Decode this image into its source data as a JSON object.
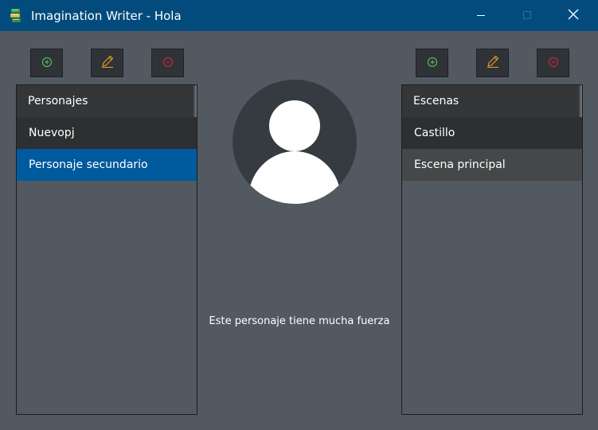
{
  "window": {
    "title": "Imagination Writer - Hola",
    "icons": {
      "app": "books-icon",
      "minimize": "minimize-icon",
      "maximize": "maximize-icon",
      "close": "close-icon"
    }
  },
  "characters": {
    "toolbar": {
      "add_icon": "plus-circle-icon",
      "edit_icon": "pencil-icon",
      "remove_icon": "minus-circle-icon"
    },
    "header": "Personajes",
    "items": [
      {
        "label": "Nuevopj",
        "state": "normal"
      },
      {
        "label": "Personaje secundario",
        "state": "selected"
      }
    ]
  },
  "detail": {
    "avatar_icon": "user-avatar-icon",
    "description": "Este personaje tiene mucha fuerza"
  },
  "scenes": {
    "toolbar": {
      "add_icon": "plus-circle-icon",
      "edit_icon": "pencil-icon",
      "remove_icon": "minus-circle-icon"
    },
    "header": "Escenas",
    "items": [
      {
        "label": "Castillo",
        "state": "normal"
      },
      {
        "label": "Escena principal",
        "state": "hover"
      }
    ]
  },
  "colors": {
    "titlebar": "#044b7d",
    "background": "#525960",
    "selected": "#005a9e",
    "add_icon": "#5ad15a",
    "edit_icon": "#f0a020",
    "remove_icon": "#e0242c"
  }
}
